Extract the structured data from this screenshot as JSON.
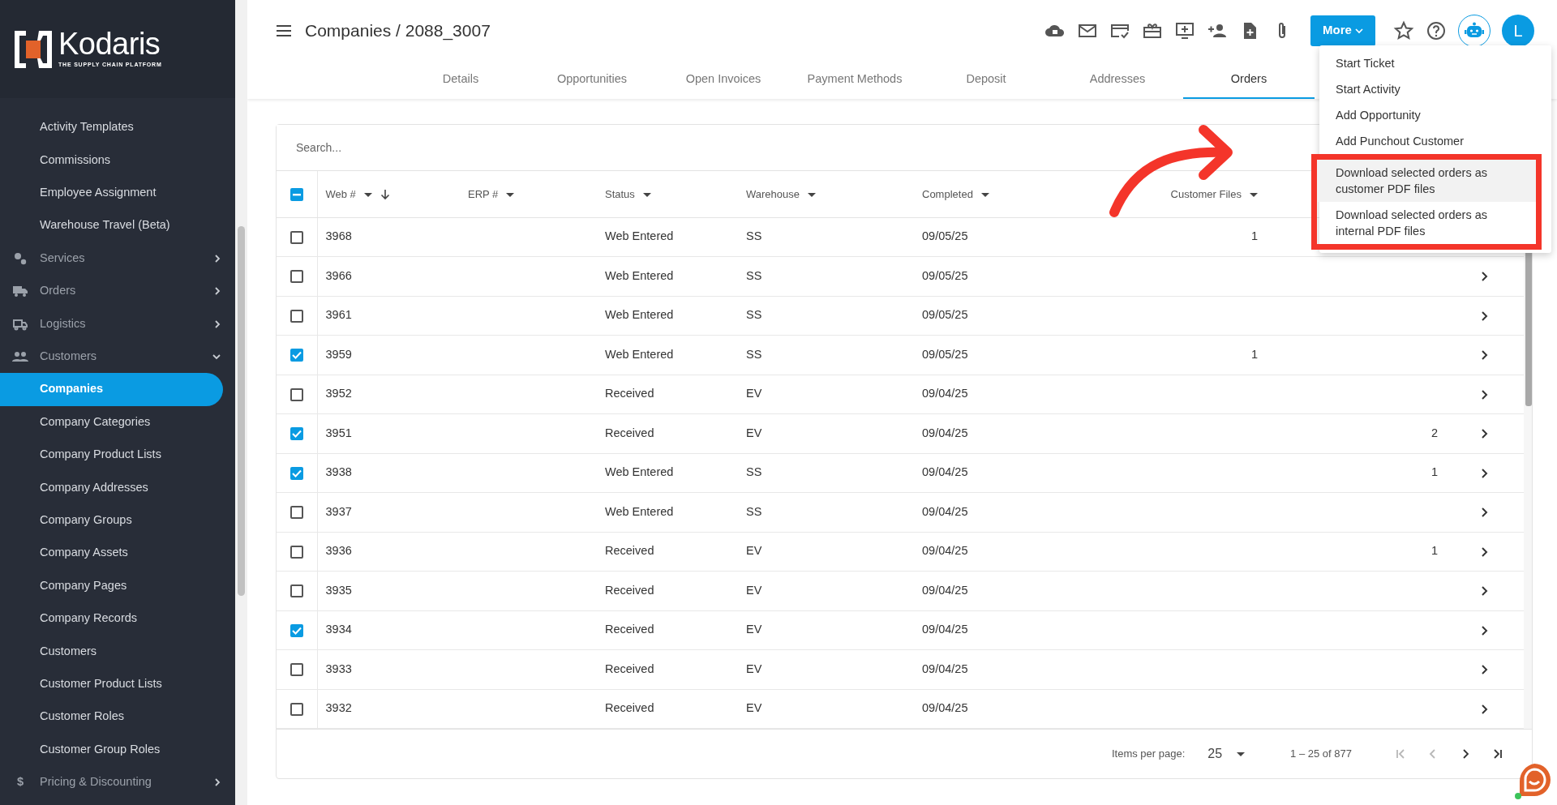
{
  "sidebar": {
    "logo": {
      "name": "Kodaris",
      "tagline": "THE SUPPLY CHAIN PLATFORM"
    },
    "items": [
      {
        "label": "Activity Templates",
        "kind": "link",
        "selected": false
      },
      {
        "label": "Commissions",
        "kind": "link",
        "selected": false
      },
      {
        "label": "Employee Assignment",
        "kind": "link",
        "selected": false
      },
      {
        "label": "Warehouse Travel (Beta)",
        "kind": "link",
        "selected": false
      },
      {
        "label": "Services",
        "kind": "group",
        "expanded": false
      },
      {
        "label": "Orders",
        "kind": "group",
        "expanded": false
      },
      {
        "label": "Logistics",
        "kind": "group",
        "expanded": false
      },
      {
        "label": "Customers",
        "kind": "group",
        "expanded": true,
        "children": [
          {
            "label": "Companies",
            "selected": true
          },
          {
            "label": "Company Categories",
            "selected": false
          },
          {
            "label": "Company Product Lists",
            "selected": false
          },
          {
            "label": "Company Addresses",
            "selected": false
          },
          {
            "label": "Company Groups",
            "selected": false
          },
          {
            "label": "Company Assets",
            "selected": false
          },
          {
            "label": "Company Pages",
            "selected": false
          },
          {
            "label": "Company Records",
            "selected": false
          },
          {
            "label": "Customers",
            "selected": false
          },
          {
            "label": "Customer Product Lists",
            "selected": false
          },
          {
            "label": "Customer Roles",
            "selected": false
          },
          {
            "label": "Customer Group Roles",
            "selected": false
          }
        ]
      },
      {
        "label": "Pricing & Discounting",
        "kind": "group",
        "expanded": false,
        "icon_text": "$"
      }
    ]
  },
  "header": {
    "title": "Companies / 2088_3007",
    "more_button": "More",
    "avatar": "L"
  },
  "tabs": [
    {
      "label": "Details",
      "selected": false
    },
    {
      "label": "Opportunities",
      "selected": false
    },
    {
      "label": "Open Invoices",
      "selected": false
    },
    {
      "label": "Payment Methods",
      "selected": false
    },
    {
      "label": "Deposit",
      "selected": false
    },
    {
      "label": "Addresses",
      "selected": false
    },
    {
      "label": "Orders",
      "selected": true
    }
  ],
  "menu": {
    "items": [
      {
        "label": "Start Ticket",
        "highlighted": false,
        "boxed": false
      },
      {
        "label": "Start Activity",
        "highlighted": false,
        "boxed": false
      },
      {
        "label": "Add Opportunity",
        "highlighted": false,
        "boxed": false
      },
      {
        "label": "Add Punchout Customer",
        "highlighted": false,
        "boxed": false
      },
      {
        "label": "Download selected orders as customer PDF files",
        "highlighted": true,
        "boxed": true
      },
      {
        "label": "Download selected orders as internal PDF files",
        "highlighted": false,
        "boxed": true
      }
    ]
  },
  "table": {
    "search": {
      "placeholder": "Search..."
    },
    "select_all": {
      "indeterminate": true
    },
    "columns": [
      {
        "label": "Web #",
        "sorted_descending": true
      },
      {
        "label": "ERP #"
      },
      {
        "label": "Status"
      },
      {
        "label": "Warehouse"
      },
      {
        "label": "Completed"
      },
      {
        "label": "Customer Files"
      }
    ],
    "rows": [
      {
        "selected": false,
        "web": "3968",
        "status": "Web Entered",
        "warehouse": "SS",
        "completed": "09/05/25",
        "customer_files": "1"
      },
      {
        "selected": false,
        "web": "3966",
        "status": "Web Entered",
        "warehouse": "SS",
        "completed": "09/05/25"
      },
      {
        "selected": false,
        "web": "3961",
        "status": "Web Entered",
        "warehouse": "SS",
        "completed": "09/05/25"
      },
      {
        "selected": true,
        "web": "3959",
        "status": "Web Entered",
        "warehouse": "SS",
        "completed": "09/05/25",
        "customer_files": "1"
      },
      {
        "selected": false,
        "web": "3952",
        "status": "Received",
        "warehouse": "EV",
        "completed": "09/04/25"
      },
      {
        "selected": true,
        "web": "3951",
        "status": "Received",
        "warehouse": "EV",
        "completed": "09/04/25",
        "column_8": "2"
      },
      {
        "selected": true,
        "web": "3938",
        "status": "Web Entered",
        "warehouse": "SS",
        "completed": "09/04/25",
        "column_8": "1"
      },
      {
        "selected": false,
        "web": "3937",
        "status": "Web Entered",
        "warehouse": "SS",
        "completed": "09/04/25"
      },
      {
        "selected": false,
        "web": "3936",
        "status": "Received",
        "warehouse": "EV",
        "completed": "09/04/25",
        "column_8": "1"
      },
      {
        "selected": false,
        "web": "3935",
        "status": "Received",
        "warehouse": "EV",
        "completed": "09/04/25"
      },
      {
        "selected": true,
        "web": "3934",
        "status": "Received",
        "warehouse": "EV",
        "completed": "09/04/25"
      },
      {
        "selected": false,
        "web": "3933",
        "status": "Received",
        "warehouse": "EV",
        "completed": "09/04/25"
      },
      {
        "selected": false,
        "web": "3932",
        "status": "Received",
        "warehouse": "EV",
        "completed": "09/04/25"
      }
    ]
  },
  "pagination": {
    "items_per_page_label": "Items per page:",
    "page_size": "25",
    "range": "1 – 25 of 877",
    "buttons": [
      {
        "kind": "first",
        "disabled": true
      },
      {
        "kind": "prev",
        "disabled": true
      },
      {
        "kind": "next",
        "disabled": false
      },
      {
        "kind": "last",
        "disabled": false
      }
    ]
  }
}
